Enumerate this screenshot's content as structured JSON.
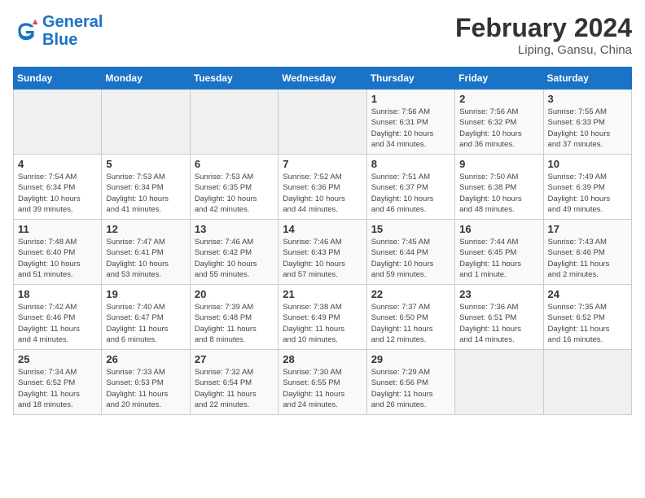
{
  "header": {
    "logo_line1": "General",
    "logo_line2": "Blue",
    "month": "February 2024",
    "location": "Liping, Gansu, China"
  },
  "weekdays": [
    "Sunday",
    "Monday",
    "Tuesday",
    "Wednesday",
    "Thursday",
    "Friday",
    "Saturday"
  ],
  "weeks": [
    [
      {
        "day": "",
        "info": ""
      },
      {
        "day": "",
        "info": ""
      },
      {
        "day": "",
        "info": ""
      },
      {
        "day": "",
        "info": ""
      },
      {
        "day": "1",
        "info": "Sunrise: 7:56 AM\nSunset: 6:31 PM\nDaylight: 10 hours\nand 34 minutes."
      },
      {
        "day": "2",
        "info": "Sunrise: 7:56 AM\nSunset: 6:32 PM\nDaylight: 10 hours\nand 36 minutes."
      },
      {
        "day": "3",
        "info": "Sunrise: 7:55 AM\nSunset: 6:33 PM\nDaylight: 10 hours\nand 37 minutes."
      }
    ],
    [
      {
        "day": "4",
        "info": "Sunrise: 7:54 AM\nSunset: 6:34 PM\nDaylight: 10 hours\nand 39 minutes."
      },
      {
        "day": "5",
        "info": "Sunrise: 7:53 AM\nSunset: 6:34 PM\nDaylight: 10 hours\nand 41 minutes."
      },
      {
        "day": "6",
        "info": "Sunrise: 7:53 AM\nSunset: 6:35 PM\nDaylight: 10 hours\nand 42 minutes."
      },
      {
        "day": "7",
        "info": "Sunrise: 7:52 AM\nSunset: 6:36 PM\nDaylight: 10 hours\nand 44 minutes."
      },
      {
        "day": "8",
        "info": "Sunrise: 7:51 AM\nSunset: 6:37 PM\nDaylight: 10 hours\nand 46 minutes."
      },
      {
        "day": "9",
        "info": "Sunrise: 7:50 AM\nSunset: 6:38 PM\nDaylight: 10 hours\nand 48 minutes."
      },
      {
        "day": "10",
        "info": "Sunrise: 7:49 AM\nSunset: 6:39 PM\nDaylight: 10 hours\nand 49 minutes."
      }
    ],
    [
      {
        "day": "11",
        "info": "Sunrise: 7:48 AM\nSunset: 6:40 PM\nDaylight: 10 hours\nand 51 minutes."
      },
      {
        "day": "12",
        "info": "Sunrise: 7:47 AM\nSunset: 6:41 PM\nDaylight: 10 hours\nand 53 minutes."
      },
      {
        "day": "13",
        "info": "Sunrise: 7:46 AM\nSunset: 6:42 PM\nDaylight: 10 hours\nand 55 minutes."
      },
      {
        "day": "14",
        "info": "Sunrise: 7:46 AM\nSunset: 6:43 PM\nDaylight: 10 hours\nand 57 minutes."
      },
      {
        "day": "15",
        "info": "Sunrise: 7:45 AM\nSunset: 6:44 PM\nDaylight: 10 hours\nand 59 minutes."
      },
      {
        "day": "16",
        "info": "Sunrise: 7:44 AM\nSunset: 6:45 PM\nDaylight: 11 hours\nand 1 minute."
      },
      {
        "day": "17",
        "info": "Sunrise: 7:43 AM\nSunset: 6:46 PM\nDaylight: 11 hours\nand 2 minutes."
      }
    ],
    [
      {
        "day": "18",
        "info": "Sunrise: 7:42 AM\nSunset: 6:46 PM\nDaylight: 11 hours\nand 4 minutes."
      },
      {
        "day": "19",
        "info": "Sunrise: 7:40 AM\nSunset: 6:47 PM\nDaylight: 11 hours\nand 6 minutes."
      },
      {
        "day": "20",
        "info": "Sunrise: 7:39 AM\nSunset: 6:48 PM\nDaylight: 11 hours\nand 8 minutes."
      },
      {
        "day": "21",
        "info": "Sunrise: 7:38 AM\nSunset: 6:49 PM\nDaylight: 11 hours\nand 10 minutes."
      },
      {
        "day": "22",
        "info": "Sunrise: 7:37 AM\nSunset: 6:50 PM\nDaylight: 11 hours\nand 12 minutes."
      },
      {
        "day": "23",
        "info": "Sunrise: 7:36 AM\nSunset: 6:51 PM\nDaylight: 11 hours\nand 14 minutes."
      },
      {
        "day": "24",
        "info": "Sunrise: 7:35 AM\nSunset: 6:52 PM\nDaylight: 11 hours\nand 16 minutes."
      }
    ],
    [
      {
        "day": "25",
        "info": "Sunrise: 7:34 AM\nSunset: 6:52 PM\nDaylight: 11 hours\nand 18 minutes."
      },
      {
        "day": "26",
        "info": "Sunrise: 7:33 AM\nSunset: 6:53 PM\nDaylight: 11 hours\nand 20 minutes."
      },
      {
        "day": "27",
        "info": "Sunrise: 7:32 AM\nSunset: 6:54 PM\nDaylight: 11 hours\nand 22 minutes."
      },
      {
        "day": "28",
        "info": "Sunrise: 7:30 AM\nSunset: 6:55 PM\nDaylight: 11 hours\nand 24 minutes."
      },
      {
        "day": "29",
        "info": "Sunrise: 7:29 AM\nSunset: 6:56 PM\nDaylight: 11 hours\nand 26 minutes."
      },
      {
        "day": "",
        "info": ""
      },
      {
        "day": "",
        "info": ""
      }
    ]
  ]
}
